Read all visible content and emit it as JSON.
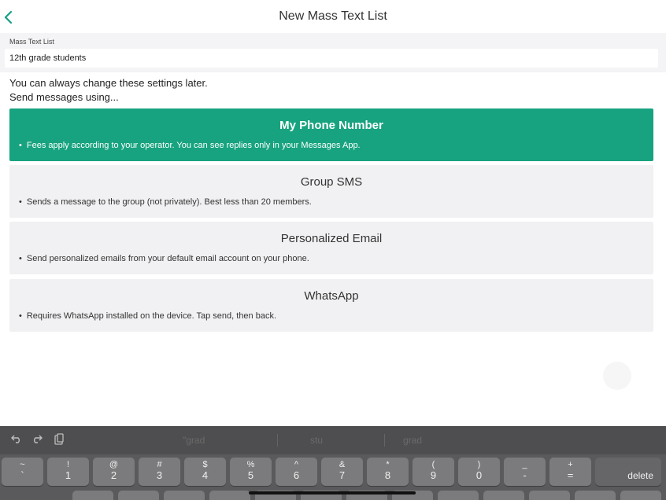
{
  "header": {
    "title": "New Mass Text List"
  },
  "form": {
    "field_label": "Mass Text List",
    "field_value": "12th grade students"
  },
  "hints": {
    "line1": "You can always change these settings later.",
    "line2": "Send messages using..."
  },
  "options": [
    {
      "title": "My Phone Number",
      "desc": "Fees apply according to your operator. You can see replies only in your Messages App.",
      "selected": true
    },
    {
      "title": "Group SMS",
      "desc": "Sends a message to the group (not privately). Best less than 20 members.",
      "selected": false
    },
    {
      "title": "Personalized Email",
      "desc": "Send personalized emails from your default email account on your phone.",
      "selected": false
    },
    {
      "title": "WhatsApp",
      "desc": "Requires WhatsApp installed on the device. Tap send, then back.",
      "selected": false
    }
  ],
  "keyboard": {
    "suggestions": [
      "\"grad",
      "stu",
      "grad"
    ],
    "keys": [
      {
        "top": "~",
        "bottom": "`"
      },
      {
        "top": "!",
        "bottom": "1"
      },
      {
        "top": "@",
        "bottom": "2"
      },
      {
        "top": "#",
        "bottom": "3"
      },
      {
        "top": "$",
        "bottom": "4"
      },
      {
        "top": "%",
        "bottom": "5"
      },
      {
        "top": "^",
        "bottom": "6"
      },
      {
        "top": "&",
        "bottom": "7"
      },
      {
        "top": "*",
        "bottom": "8"
      },
      {
        "top": "(",
        "bottom": "9"
      },
      {
        "top": ")",
        "bottom": "0"
      },
      {
        "top": "_",
        "bottom": "-"
      },
      {
        "top": "+",
        "bottom": "="
      }
    ],
    "delete_label": "delete"
  },
  "colors": {
    "accent": "#17a37f",
    "card": "#f1f1f3",
    "keyboard": "#5a5a5c"
  }
}
